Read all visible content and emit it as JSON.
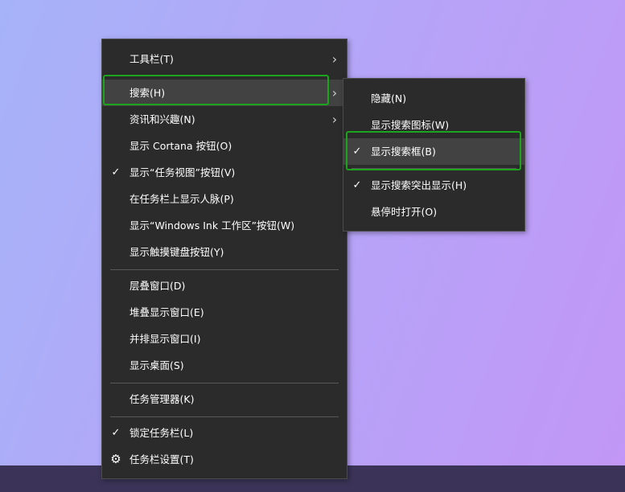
{
  "main_menu": {
    "items": [
      {
        "label": "工具栏(T)"
      },
      {
        "label": "搜索(H)"
      },
      {
        "label": "资讯和兴趣(N)"
      },
      {
        "label": "显示 Cortana 按钮(O)"
      },
      {
        "label": "显示“任务视图”按钮(V)"
      },
      {
        "label": "在任务栏上显示人脉(P)"
      },
      {
        "label": "显示“Windows Ink 工作区”按钮(W)"
      },
      {
        "label": "显示触摸键盘按钮(Y)"
      },
      {
        "label": "层叠窗口(D)"
      },
      {
        "label": "堆叠显示窗口(E)"
      },
      {
        "label": "并排显示窗口(I)"
      },
      {
        "label": "显示桌面(S)"
      },
      {
        "label": "任务管理器(K)"
      },
      {
        "label": "锁定任务栏(L)"
      },
      {
        "label": "任务栏设置(T)"
      }
    ],
    "check_mark": "✓",
    "arrow_icon": "chevron-right-icon",
    "settings_icon": "gear-icon",
    "gear_glyph": "⚙"
  },
  "search_submenu": {
    "items": [
      {
        "label": "隐藏(N)"
      },
      {
        "label": "显示搜索图标(W)"
      },
      {
        "label": "显示搜索框(B)"
      },
      {
        "label": "显示搜索突出显示(H)"
      },
      {
        "label": "悬停时打开(O)"
      }
    ]
  },
  "colors": {
    "menu_bg": "#2b2b2b",
    "highlight_bg": "#424242",
    "focus_outline": "#1aa51a",
    "taskbar_bg": "#3b3458"
  }
}
